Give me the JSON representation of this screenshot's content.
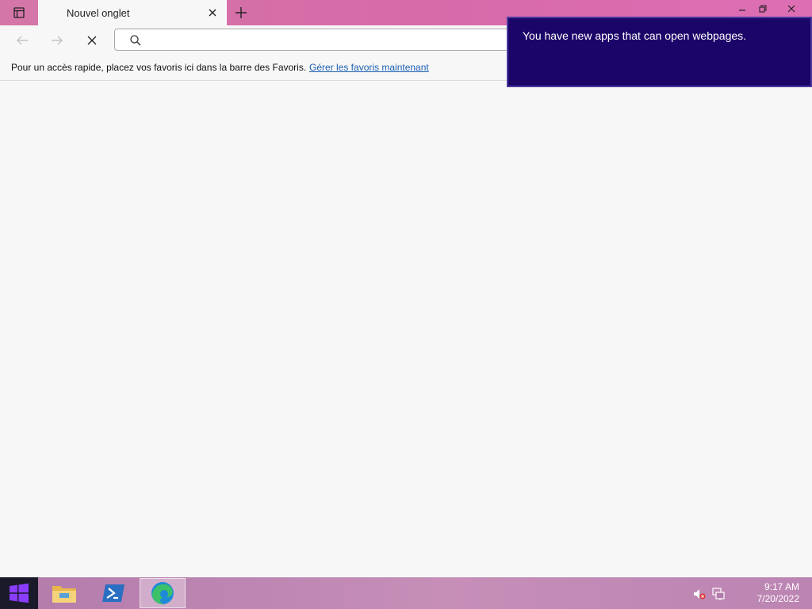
{
  "browser": {
    "tab": {
      "title": "Nouvel onglet"
    },
    "address_bar": {
      "value": "",
      "placeholder": ""
    },
    "favorites_bar": {
      "prompt": "Pour un accès rapide, placez vos favoris ici dans la barre des Favoris.",
      "manage_link": "Gérer les favoris maintenant"
    },
    "icons": {
      "tab_actions": "tab-actions-icon",
      "tab_close": "close-icon",
      "new_tab": "plus-icon",
      "back": "arrow-left-icon",
      "forward": "arrow-right-icon",
      "stop": "close-icon",
      "search": "search-icon",
      "minimize": "minimize-icon",
      "restore": "restore-icon",
      "close_window": "close-icon"
    }
  },
  "toast": {
    "message": "You have new apps that can open webpages."
  },
  "taskbar": {
    "apps": [
      "file-explorer-icon",
      "powershell-icon",
      "edge-icon"
    ],
    "tray_icons": [
      "volume-muted-icon",
      "network-icon"
    ],
    "time": "9:17 AM",
    "date": "7/20/2022"
  },
  "colors": {
    "titlebar": "#d66aa8",
    "toast_bg": "#1c0569",
    "link": "#1a5fb4",
    "taskbar": "#c08ab5"
  }
}
